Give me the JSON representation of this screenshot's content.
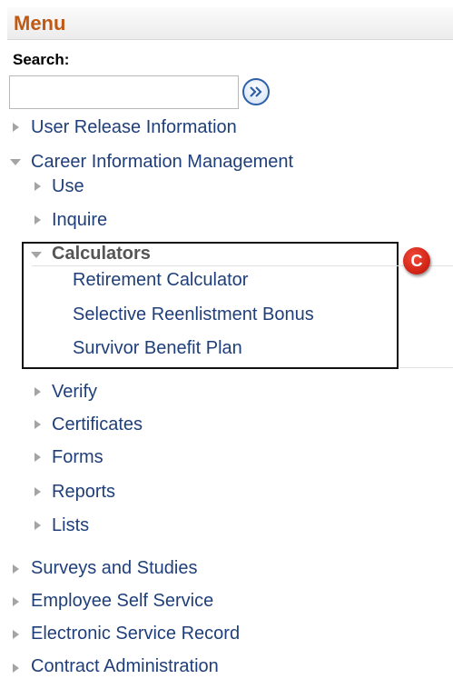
{
  "menu": {
    "title": "Menu"
  },
  "search": {
    "label": "Search:",
    "value": "",
    "placeholder": ""
  },
  "nav": {
    "user_release": "User Release Information",
    "career_info": "Career Information Management",
    "career_children": {
      "use": "Use",
      "inquire": "Inquire",
      "calculators": "Calculators",
      "verify": "Verify",
      "certificates": "Certificates",
      "forms": "Forms",
      "reports": "Reports",
      "lists": "Lists"
    },
    "calculators_children": {
      "retirement": "Retirement Calculator",
      "srb": "Selective Reenlistment Bonus",
      "sbp": "Survivor Benefit Plan"
    },
    "surveys": "Surveys and Studies",
    "employee_self_service": "Employee Self Service",
    "electronic_service_record": "Electronic Service Record",
    "contract_admin": "Contract Administration"
  },
  "annotation": {
    "badge_letter": "C"
  },
  "colors": {
    "menu_title": "#bf5a14",
    "link": "#1f3f7a",
    "badge": "#d42618",
    "highlight_border": "#111111"
  }
}
